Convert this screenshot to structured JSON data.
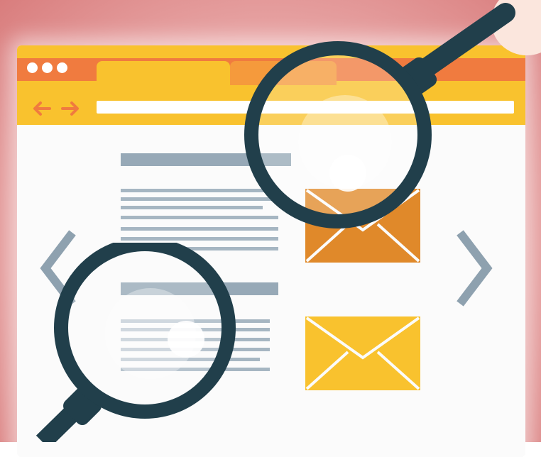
{
  "illustration": {
    "subject": "browser-window-with-magnifying-glasses",
    "colors": {
      "background": "#e9a9a9",
      "frame_yellow": "#f9c22e",
      "tab_orange": "#f07b3f",
      "text_gray": "#97a9b7",
      "envelope_dark": "#e0892a",
      "envelope_light": "#f9c22e",
      "magnifier_ring": "#213f4b",
      "arrow_gray": "#8ea1af"
    },
    "icons": {
      "window_controls": [
        "dot-icon",
        "dot-icon",
        "dot-icon"
      ],
      "navigation": [
        "back-arrow-icon",
        "forward-arrow-icon"
      ],
      "carousel": [
        "chevron-left-icon",
        "chevron-right-icon"
      ],
      "content": [
        "envelope-icon",
        "envelope-icon"
      ],
      "tools": [
        "magnifying-glass-icon",
        "magnifying-glass-icon"
      ]
    }
  }
}
